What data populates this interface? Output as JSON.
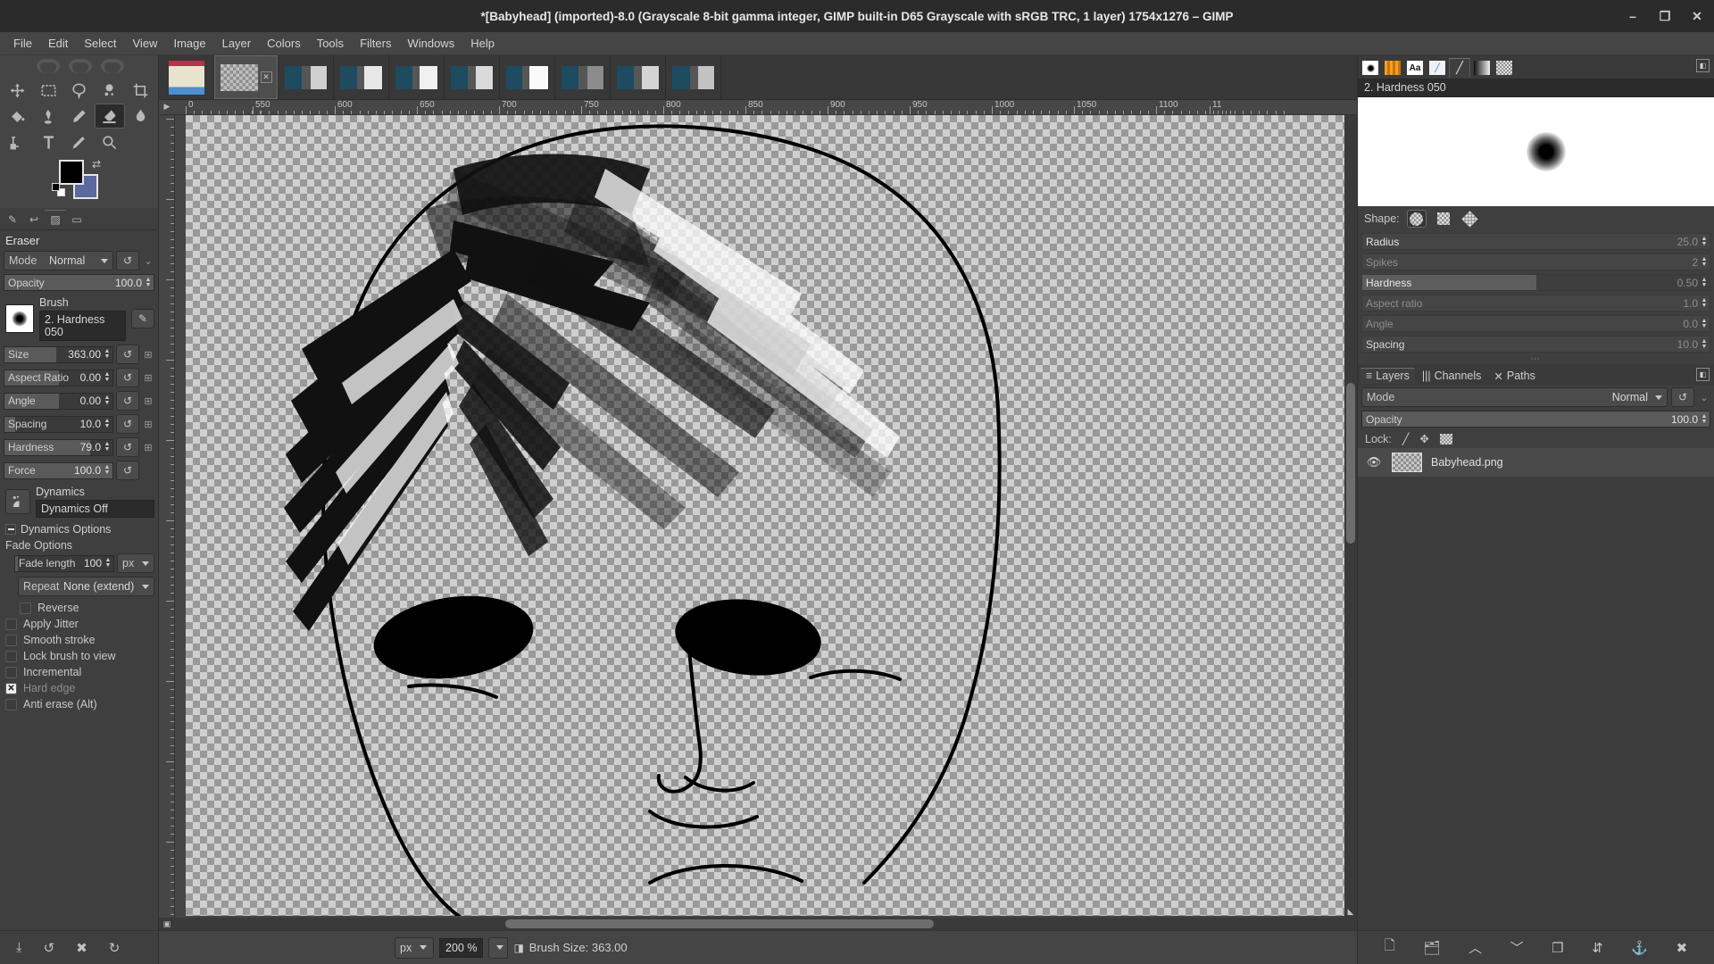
{
  "window": {
    "title": "*[Babyhead] (imported)-8.0 (Grayscale 8-bit gamma integer, GIMP built-in D65 Grayscale with sRGB TRC, 1 layer) 1754x1276 – GIMP",
    "minimize": "–",
    "maximize": "❐",
    "close": "✕"
  },
  "menubar": {
    "items": [
      {
        "label": "File"
      },
      {
        "label": "Edit"
      },
      {
        "label": "Select"
      },
      {
        "label": "View"
      },
      {
        "label": "Image"
      },
      {
        "label": "Layer"
      },
      {
        "label": "Colors"
      },
      {
        "label": "Tools"
      },
      {
        "label": "Filters"
      },
      {
        "label": "Windows"
      },
      {
        "label": "Help"
      }
    ]
  },
  "toolbox": {
    "tools": [
      {
        "name": "move-tool",
        "title": "Move"
      },
      {
        "name": "rectangle-select-tool",
        "title": "Rectangle Select"
      },
      {
        "name": "free-select-tool",
        "title": "Free Select"
      },
      {
        "name": "fuzzy-select-tool",
        "title": "Fuzzy Select"
      },
      {
        "name": "crop-tool",
        "title": "Crop"
      },
      {
        "name": "bucket-fill-tool",
        "title": "Bucket Fill"
      },
      {
        "name": "ink-tool",
        "title": "Ink"
      },
      {
        "name": "pencil-tool",
        "title": "Pencil"
      },
      {
        "name": "eraser-tool",
        "title": "Eraser"
      },
      {
        "name": "smudge-tool",
        "title": "Smudge"
      },
      {
        "name": "paths-tool",
        "title": "Paths"
      },
      {
        "name": "text-tool",
        "title": "Text"
      },
      {
        "name": "color-picker-tool",
        "title": "Color Picker"
      },
      {
        "name": "zoom-tool",
        "title": "Zoom"
      }
    ],
    "active_tool": "eraser-tool",
    "foreground_color": "#000000",
    "background_color": "#5a6a9e",
    "swap_icon": "⇄"
  },
  "dock_tabs": [
    {
      "name": "tool-options-tab",
      "icon": "✎"
    },
    {
      "name": "undo-history-tab",
      "icon": "↩"
    },
    {
      "name": "images-tab",
      "icon": "▨"
    },
    {
      "name": "device-status-tab",
      "icon": "▭"
    }
  ],
  "tool_options": {
    "tool_name": "Eraser",
    "mode_label": "Mode",
    "mode_value": "Normal",
    "opacity_label": "Opacity",
    "opacity_value": "100.0",
    "brush_caption": "Brush",
    "brush_name": "2. Hardness 050",
    "sliders": [
      {
        "label": "Size",
        "value": "363.00",
        "fill_pct": 48
      },
      {
        "label": "Aspect Ratio",
        "value": "0.00",
        "fill_pct": 50
      },
      {
        "label": "Angle",
        "value": "0.00",
        "fill_pct": 50
      },
      {
        "label": "Spacing",
        "value": "10.0",
        "fill_pct": 10
      },
      {
        "label": "Hardness",
        "value": "79.0",
        "fill_pct": 79
      },
      {
        "label": "Force",
        "value": "100.0",
        "fill_pct": 100
      }
    ],
    "dynamics_caption": "Dynamics",
    "dynamics_value": "Dynamics Off",
    "dynamics_options_label": "Dynamics Options",
    "fade_options_label": "Fade Options",
    "fade_length_label": "Fade length",
    "fade_length_value": "100",
    "fade_unit": "px",
    "repeat_label": "Repeat",
    "repeat_value": "None (extend)",
    "checkboxes": [
      {
        "label": "Reverse",
        "checked": false,
        "dim": false,
        "indent": true
      },
      {
        "label": "Apply Jitter",
        "checked": false,
        "dim": false,
        "indent": false
      },
      {
        "label": "Smooth stroke",
        "checked": false,
        "dim": false,
        "indent": false
      },
      {
        "label": "Lock brush to view",
        "checked": false,
        "dim": false,
        "indent": false
      },
      {
        "label": "Incremental",
        "checked": false,
        "dim": false,
        "indent": false
      },
      {
        "label": "Hard edge",
        "checked": true,
        "dim": true,
        "indent": false
      },
      {
        "label": "Anti erase  (Alt)",
        "checked": false,
        "dim": false,
        "indent": false
      }
    ]
  },
  "left_bottom_buttons": [
    {
      "name": "save-tool-preset-button",
      "icon": "⤓"
    },
    {
      "name": "restore-tool-preset-button",
      "icon": "↺"
    },
    {
      "name": "delete-tool-preset-button",
      "icon": "✖"
    },
    {
      "name": "reset-tool-options-button",
      "icon": "↻"
    }
  ],
  "canvas": {
    "ruler_unit_labels": [
      "0",
      "550",
      "600",
      "650",
      "700",
      "750",
      "800",
      "850",
      "900",
      "950",
      "1000",
      "1050",
      "1100",
      "11"
    ],
    "ruler_left_labels": [
      "1"
    ]
  },
  "statusbar": {
    "unit": "px",
    "zoom": "200 %",
    "message": "Brush Size: 363.00"
  },
  "right_dock": {
    "tabs": [
      {
        "name": "brushes-tab",
        "icon": "brush-dot-icon"
      },
      {
        "name": "patterns-tab",
        "icon": "pattern-icon"
      },
      {
        "name": "fonts-tab",
        "icon": "Aa"
      },
      {
        "name": "document-history-tab",
        "icon": "doc-icon"
      },
      {
        "name": "brush-editor-tab",
        "icon": "paintbrush-icon"
      },
      {
        "name": "gradients-tab",
        "icon": "gradient-icon"
      },
      {
        "name": "palettes-tab",
        "icon": "palette-icon"
      }
    ],
    "selected_tab": "brush-editor-tab",
    "menu_icon": "◧",
    "brush_editor": {
      "brush_name": "2. Hardness 050",
      "shape_label": "Shape:",
      "shapes": [
        "circle",
        "square",
        "diamond"
      ],
      "selected_shape": "circle",
      "params": [
        {
          "label": "Radius",
          "value": "25.0",
          "fill_pct": 0,
          "active": true
        },
        {
          "label": "Spikes",
          "value": "2",
          "fill_pct": 0,
          "active": false
        },
        {
          "label": "Hardness",
          "value": "0.50",
          "fill_pct": 50,
          "active": true
        },
        {
          "label": "Aspect ratio",
          "value": "1.0",
          "fill_pct": 0,
          "active": false
        },
        {
          "label": "Angle",
          "value": "0.0",
          "fill_pct": 0,
          "active": false
        },
        {
          "label": "Spacing",
          "value": "10.0",
          "fill_pct": 0,
          "active": true
        }
      ]
    },
    "layers_panel": {
      "tabs": [
        {
          "label": "Layers",
          "name": "tab-layers"
        },
        {
          "label": "Channels",
          "name": "tab-channels"
        },
        {
          "label": "Paths",
          "name": "tab-paths"
        }
      ],
      "selected_tab": "Layers",
      "mode_label": "Mode",
      "mode_value": "Normal",
      "opacity_label": "Opacity",
      "opacity_value": "100.0",
      "lock_label": "Lock:",
      "lock_icons": [
        "lock-pixels-icon",
        "lock-position-icon",
        "lock-alpha-icon"
      ],
      "layers": [
        {
          "name": "Babyhead.png",
          "visible": true
        }
      ]
    },
    "bottom_buttons": [
      {
        "name": "new-layer-button",
        "icon": "new-layer-icon"
      },
      {
        "name": "new-layer-group-button",
        "icon": "new-group-icon"
      },
      {
        "name": "raise-layer-button",
        "icon": "chevron-up-icon"
      },
      {
        "name": "lower-layer-button",
        "icon": "chevron-down-icon"
      },
      {
        "name": "duplicate-layer-button",
        "icon": "duplicate-icon"
      },
      {
        "name": "anchor-layer-button",
        "icon": "anchor-icon"
      },
      {
        "name": "merge-layer-button",
        "icon": "merge-icon"
      },
      {
        "name": "delete-layer-button",
        "icon": "delete-icon"
      }
    ]
  }
}
